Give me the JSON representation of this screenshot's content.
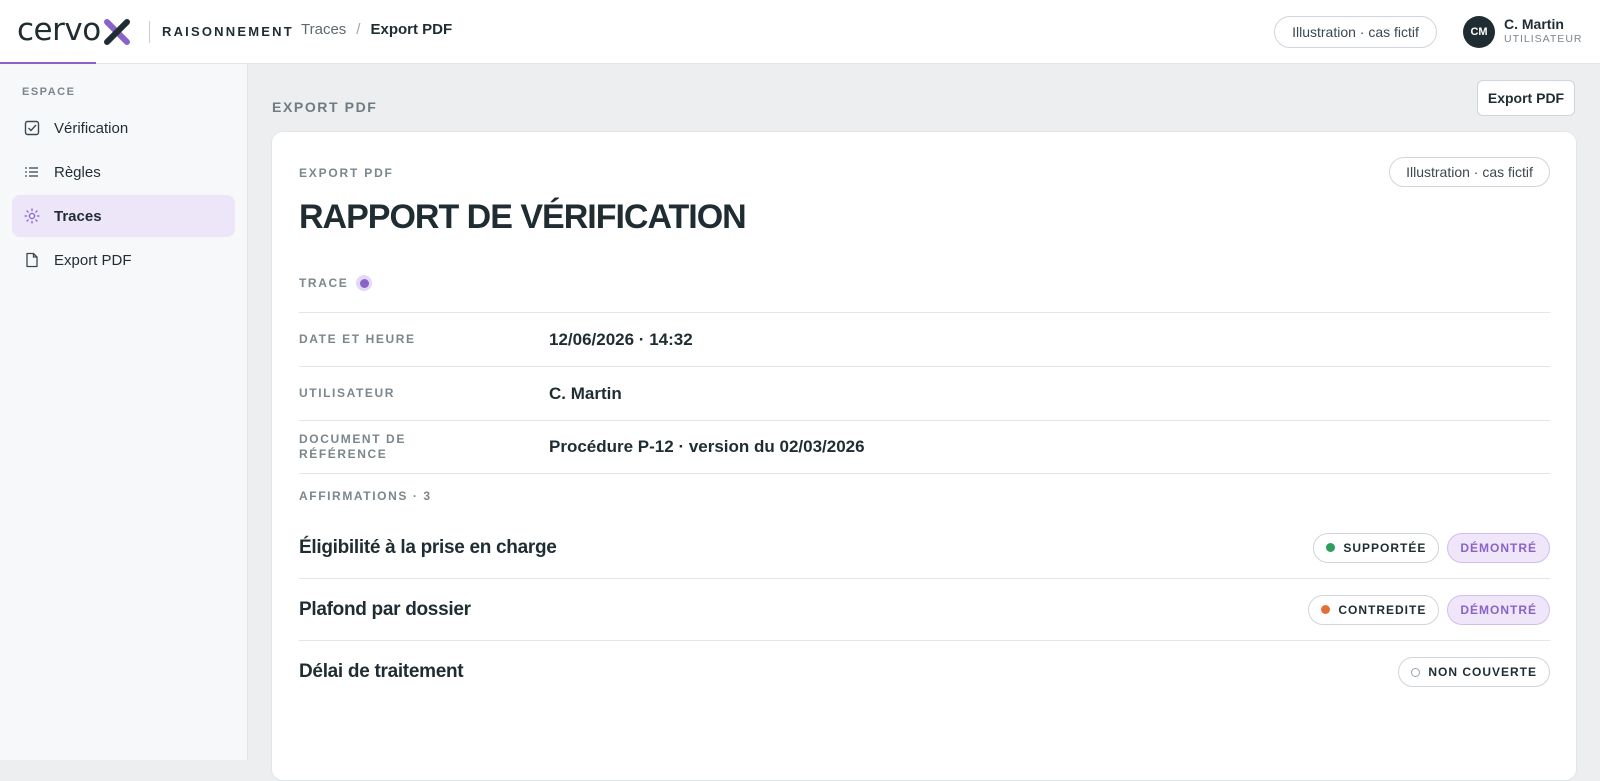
{
  "header": {
    "brand": "cervo",
    "brand_sub": "RAISONNEMENT",
    "breadcrumb": [
      "Traces",
      "Export PDF"
    ],
    "breadcrumb_separator": "/",
    "tag": "Illustration · cas fictif",
    "user": {
      "initials": "CM",
      "name": "C. Martin",
      "role": "UTILISATEUR"
    }
  },
  "sidebar": {
    "section": "ESPACE",
    "items": [
      {
        "label": "Vérification",
        "icon": "check-square-icon",
        "active": false
      },
      {
        "label": "Règles",
        "icon": "list-icon",
        "active": false
      },
      {
        "label": "Traces",
        "icon": "sun-icon",
        "active": true
      },
      {
        "label": "Export PDF",
        "icon": "file-icon",
        "active": false
      }
    ]
  },
  "main": {
    "section_label": "EXPORT PDF",
    "export_button": "Export PDF"
  },
  "card": {
    "label": "EXPORT PDF",
    "tag": "Illustration · cas fictif",
    "title": "RAPPORT DE VÉRIFICATION",
    "trace_label": "TRACE",
    "meta": [
      {
        "key": "DATE ET HEURE",
        "value": "12/06/2026 · 14:32"
      },
      {
        "key": "UTILISATEUR",
        "value": "C. Martin"
      },
      {
        "key": "DOCUMENT DE RÉFÉRENCE",
        "value": "Procédure P-12 · version du 02/03/2026"
      }
    ],
    "affirmations_label": "AFFIRMATIONS · 3",
    "affirmations": [
      {
        "title": "Éligibilité à la prise en charge",
        "status": "SUPPORTÉE",
        "status_color": "#2e9e5b",
        "proof": "DÉMONTRÉ"
      },
      {
        "title": "Plafond par dossier",
        "status": "CONTREDITE",
        "status_color": "#e07038",
        "proof": "DÉMONTRÉ"
      },
      {
        "title": "Délai de traitement",
        "status": "NON COUVERTE",
        "status_color": "hollow",
        "proof": ""
      }
    ]
  },
  "colors": {
    "accent": "#8a63c9",
    "ink": "#1f2d33",
    "background": "#eceef0"
  }
}
